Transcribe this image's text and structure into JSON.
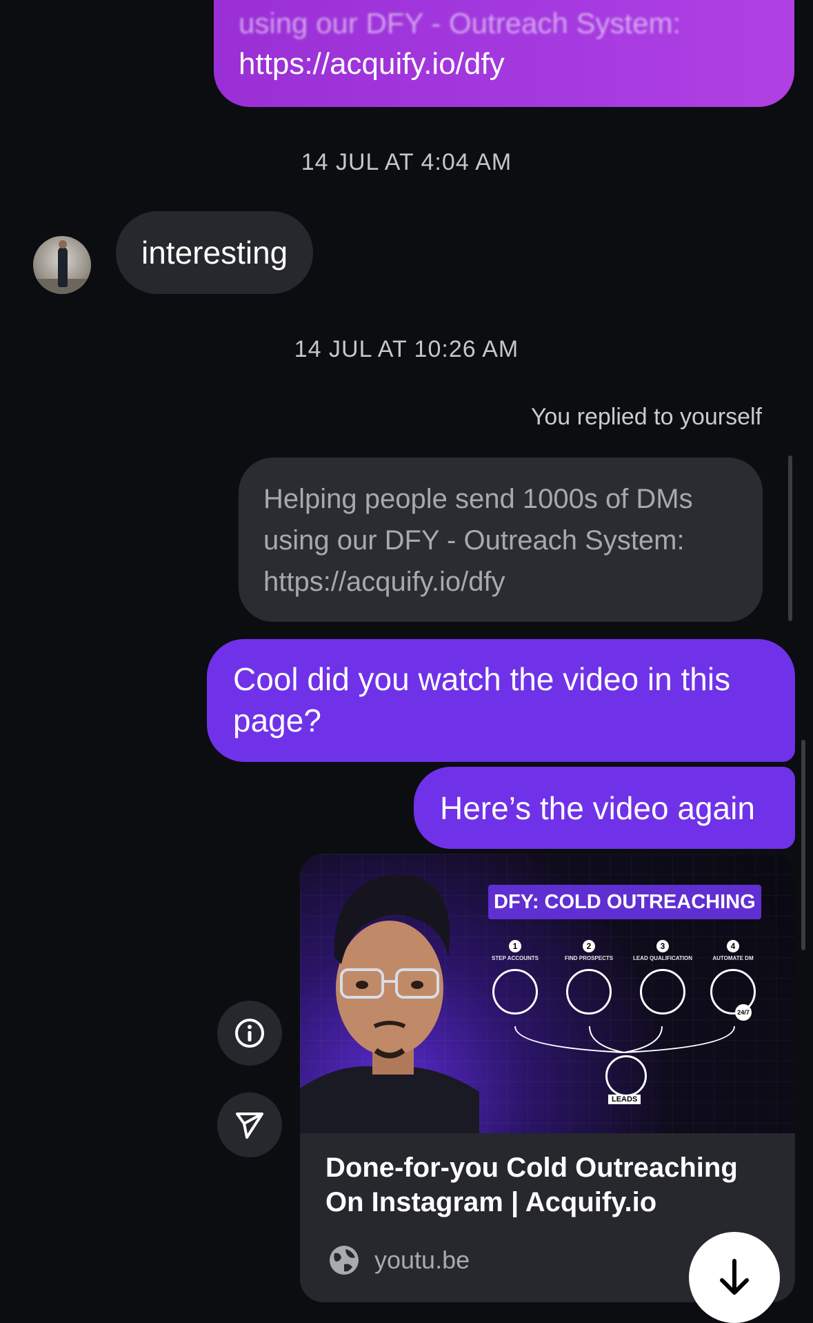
{
  "top_message": {
    "faded_line": "using our DFY - Outreach System:",
    "link": "https://acquify.io/dfy"
  },
  "timestamps": [
    "14 JUL AT 4:04 AM",
    "14 JUL AT 10:26 AM"
  ],
  "incoming": {
    "text": "interesting"
  },
  "reply_note": "You replied to yourself",
  "quoted_message": {
    "lines": [
      "Helping people send 1000s of DMs",
      "using our DFY - Outreach System:",
      "https://acquify.io/dfy"
    ]
  },
  "outgoing": [
    {
      "lines": [
        "Cool did you watch the video in this",
        "page?"
      ]
    },
    {
      "text": "Here’s the video again"
    }
  ],
  "link_card": {
    "thumbnail": {
      "headline": "DFY: COLD OUTREACHING",
      "steps": [
        {
          "num": "1",
          "label": "STEP ACCOUNTS"
        },
        {
          "num": "2",
          "label": "FIND PROSPECTS"
        },
        {
          "num": "3",
          "label": "LEAD QUALIFICATION"
        },
        {
          "num": "4",
          "label": "AUTOMATE DM"
        }
      ],
      "badge": "24/7",
      "leads_label": "LEADS"
    },
    "title_lines": [
      "Done-for-you Cold Outreaching",
      "On Instagram | Acquify.io"
    ],
    "domain": "youtu.be"
  },
  "icons": {
    "info": "info-icon",
    "share": "send-icon",
    "domain": "globe-icon",
    "scroll": "arrow-down-icon"
  },
  "colors": {
    "background": "#0b0d10",
    "outgoing_bubble": "#6f32e8",
    "incoming_bubble": "#26282d",
    "top_bubble": "#a53ae0"
  }
}
